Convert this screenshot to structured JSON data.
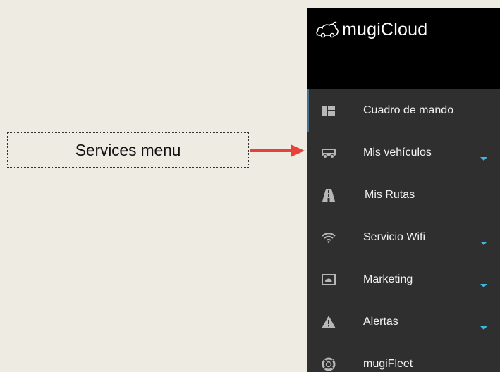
{
  "callout": {
    "label": "Services menu"
  },
  "brand": {
    "name": "mugiCloud"
  },
  "sidebar": {
    "items": [
      {
        "label": "Cuadro de mando",
        "icon": "dashboard-icon",
        "has_caret": false
      },
      {
        "label": "Mis vehículos",
        "icon": "bus-icon",
        "has_caret": true
      },
      {
        "label": "Mis Rutas",
        "icon": "road-icon",
        "has_caret": false
      },
      {
        "label": "Servicio Wifi",
        "icon": "wifi-icon",
        "has_caret": true
      },
      {
        "label": "Marketing",
        "icon": "display-icon",
        "has_caret": true
      },
      {
        "label": "Alertas",
        "icon": "warning-icon",
        "has_caret": true
      },
      {
        "label": "mugiFleet",
        "icon": "lifebuoy-icon",
        "has_caret": false
      }
    ]
  },
  "colors": {
    "background": "#EEEBE2",
    "sidebar": "#2F2F2F",
    "header": "#000000",
    "arrow": "#E8403A",
    "caret": "#3FB8E0",
    "icon": "#B7B7B7"
  }
}
